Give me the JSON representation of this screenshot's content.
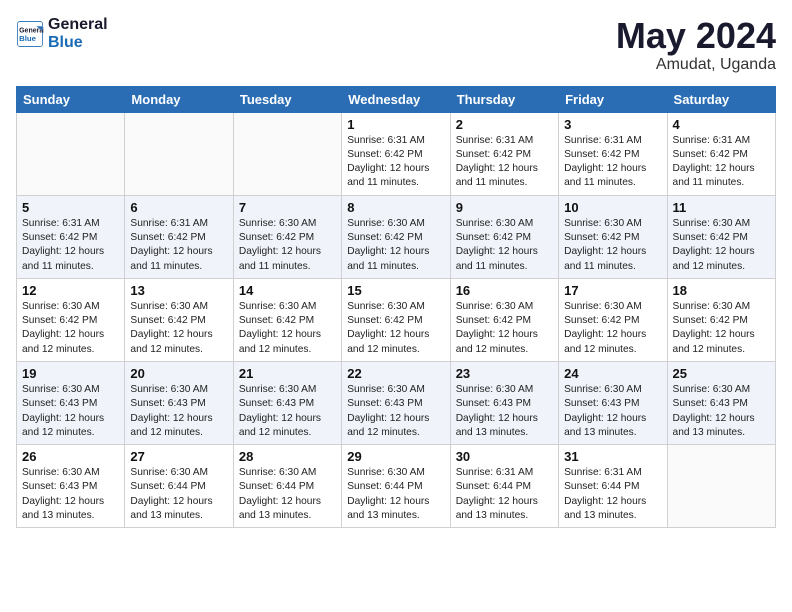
{
  "header": {
    "logo_line1": "General",
    "logo_line2": "Blue",
    "month_year": "May 2024",
    "location": "Amudat, Uganda"
  },
  "days_of_week": [
    "Sunday",
    "Monday",
    "Tuesday",
    "Wednesday",
    "Thursday",
    "Friday",
    "Saturday"
  ],
  "weeks": [
    [
      {
        "day": "",
        "content": ""
      },
      {
        "day": "",
        "content": ""
      },
      {
        "day": "",
        "content": ""
      },
      {
        "day": "1",
        "content": "Sunrise: 6:31 AM\nSunset: 6:42 PM\nDaylight: 12 hours\nand 11 minutes."
      },
      {
        "day": "2",
        "content": "Sunrise: 6:31 AM\nSunset: 6:42 PM\nDaylight: 12 hours\nand 11 minutes."
      },
      {
        "day": "3",
        "content": "Sunrise: 6:31 AM\nSunset: 6:42 PM\nDaylight: 12 hours\nand 11 minutes."
      },
      {
        "day": "4",
        "content": "Sunrise: 6:31 AM\nSunset: 6:42 PM\nDaylight: 12 hours\nand 11 minutes."
      }
    ],
    [
      {
        "day": "5",
        "content": "Sunrise: 6:31 AM\nSunset: 6:42 PM\nDaylight: 12 hours\nand 11 minutes."
      },
      {
        "day": "6",
        "content": "Sunrise: 6:31 AM\nSunset: 6:42 PM\nDaylight: 12 hours\nand 11 minutes."
      },
      {
        "day": "7",
        "content": "Sunrise: 6:30 AM\nSunset: 6:42 PM\nDaylight: 12 hours\nand 11 minutes."
      },
      {
        "day": "8",
        "content": "Sunrise: 6:30 AM\nSunset: 6:42 PM\nDaylight: 12 hours\nand 11 minutes."
      },
      {
        "day": "9",
        "content": "Sunrise: 6:30 AM\nSunset: 6:42 PM\nDaylight: 12 hours\nand 11 minutes."
      },
      {
        "day": "10",
        "content": "Sunrise: 6:30 AM\nSunset: 6:42 PM\nDaylight: 12 hours\nand 11 minutes."
      },
      {
        "day": "11",
        "content": "Sunrise: 6:30 AM\nSunset: 6:42 PM\nDaylight: 12 hours\nand 12 minutes."
      }
    ],
    [
      {
        "day": "12",
        "content": "Sunrise: 6:30 AM\nSunset: 6:42 PM\nDaylight: 12 hours\nand 12 minutes."
      },
      {
        "day": "13",
        "content": "Sunrise: 6:30 AM\nSunset: 6:42 PM\nDaylight: 12 hours\nand 12 minutes."
      },
      {
        "day": "14",
        "content": "Sunrise: 6:30 AM\nSunset: 6:42 PM\nDaylight: 12 hours\nand 12 minutes."
      },
      {
        "day": "15",
        "content": "Sunrise: 6:30 AM\nSunset: 6:42 PM\nDaylight: 12 hours\nand 12 minutes."
      },
      {
        "day": "16",
        "content": "Sunrise: 6:30 AM\nSunset: 6:42 PM\nDaylight: 12 hours\nand 12 minutes."
      },
      {
        "day": "17",
        "content": "Sunrise: 6:30 AM\nSunset: 6:42 PM\nDaylight: 12 hours\nand 12 minutes."
      },
      {
        "day": "18",
        "content": "Sunrise: 6:30 AM\nSunset: 6:42 PM\nDaylight: 12 hours\nand 12 minutes."
      }
    ],
    [
      {
        "day": "19",
        "content": "Sunrise: 6:30 AM\nSunset: 6:43 PM\nDaylight: 12 hours\nand 12 minutes."
      },
      {
        "day": "20",
        "content": "Sunrise: 6:30 AM\nSunset: 6:43 PM\nDaylight: 12 hours\nand 12 minutes."
      },
      {
        "day": "21",
        "content": "Sunrise: 6:30 AM\nSunset: 6:43 PM\nDaylight: 12 hours\nand 12 minutes."
      },
      {
        "day": "22",
        "content": "Sunrise: 6:30 AM\nSunset: 6:43 PM\nDaylight: 12 hours\nand 12 minutes."
      },
      {
        "day": "23",
        "content": "Sunrise: 6:30 AM\nSunset: 6:43 PM\nDaylight: 12 hours\nand 13 minutes."
      },
      {
        "day": "24",
        "content": "Sunrise: 6:30 AM\nSunset: 6:43 PM\nDaylight: 12 hours\nand 13 minutes."
      },
      {
        "day": "25",
        "content": "Sunrise: 6:30 AM\nSunset: 6:43 PM\nDaylight: 12 hours\nand 13 minutes."
      }
    ],
    [
      {
        "day": "26",
        "content": "Sunrise: 6:30 AM\nSunset: 6:43 PM\nDaylight: 12 hours\nand 13 minutes."
      },
      {
        "day": "27",
        "content": "Sunrise: 6:30 AM\nSunset: 6:44 PM\nDaylight: 12 hours\nand 13 minutes."
      },
      {
        "day": "28",
        "content": "Sunrise: 6:30 AM\nSunset: 6:44 PM\nDaylight: 12 hours\nand 13 minutes."
      },
      {
        "day": "29",
        "content": "Sunrise: 6:30 AM\nSunset: 6:44 PM\nDaylight: 12 hours\nand 13 minutes."
      },
      {
        "day": "30",
        "content": "Sunrise: 6:31 AM\nSunset: 6:44 PM\nDaylight: 12 hours\nand 13 minutes."
      },
      {
        "day": "31",
        "content": "Sunrise: 6:31 AM\nSunset: 6:44 PM\nDaylight: 12 hours\nand 13 minutes."
      },
      {
        "day": "",
        "content": ""
      }
    ]
  ]
}
